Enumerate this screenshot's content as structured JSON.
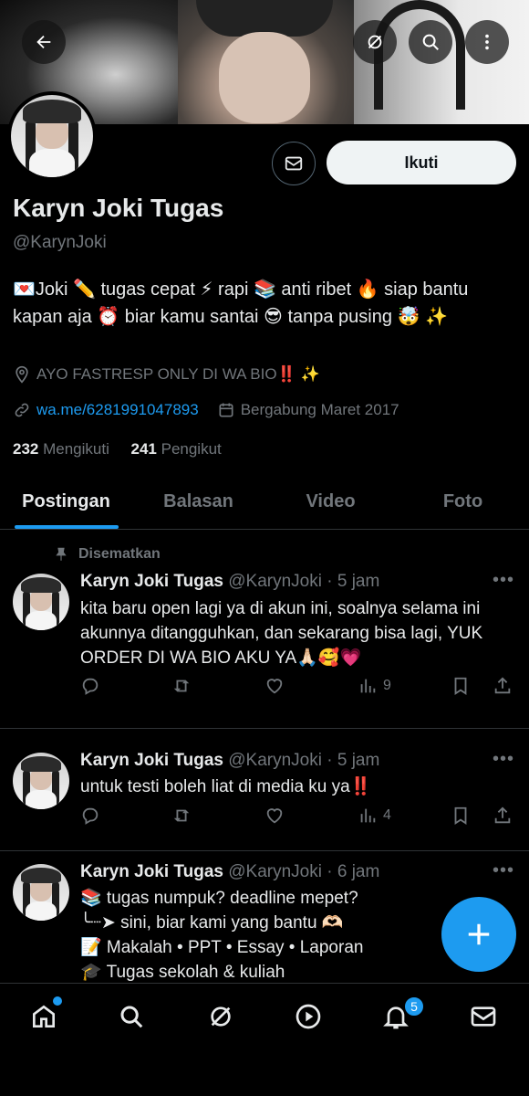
{
  "header": {
    "back_icon": "arrow-left-icon",
    "grok_icon": "grok-icon",
    "search_icon": "search-icon",
    "more_icon": "more-vertical-icon"
  },
  "profile": {
    "name": "Karyn Joki Tugas",
    "handle": "@KarynJoki",
    "bio": "💌Joki ✏️ tugas cepat ⚡ rapi 📚 anti ribet 🔥 siap bantu kapan aja ⏰ biar kamu santai 😎 tanpa pusing 🤯 ✨",
    "location": "AYO FASTRESP ONLY DI WA BIO‼️ ✨",
    "link": "wa.me/6281991047893",
    "joined": "Bergabung Maret 2017",
    "following_count": "232",
    "following_label": "Mengikuti",
    "followers_count": "241",
    "followers_label": "Pengikut",
    "follow_label": "Ikuti"
  },
  "tabs": [
    {
      "label": "Postingan",
      "active": true
    },
    {
      "label": "Balasan",
      "active": false
    },
    {
      "label": "Video",
      "active": false
    },
    {
      "label": "Foto",
      "active": false
    }
  ],
  "posts": [
    {
      "pinned_label": "Disematkan",
      "name": "Karyn Joki Tugas",
      "handle_time": "@KarynJoki · 5 jam",
      "text": "kita baru open lagi ya di akun ini, soalnya selama ini akunnya ditangguhkan, dan sekarang bisa lagi, YUK ORDER DI WA BIO AKU YA🙏🏻🥰💗",
      "views": "9"
    },
    {
      "name": "Karyn Joki Tugas",
      "handle_time": "@KarynJoki · 5 jam",
      "text": "untuk testi boleh liat di media ku ya‼️",
      "views": "4"
    },
    {
      "name": "Karyn Joki Tugas",
      "handle_time": "@KarynJoki · 6 jam",
      "lines": [
        "📚 tugas numpuk? deadline mepet?",
        "╰┈➤ sini, biar kami yang bantu 🫶🏻",
        "📝 Makalah • PPT • Essay • Laporan",
        "🎓 Tugas sekolah & kuliah"
      ]
    }
  ],
  "bottom_nav": {
    "notification_badge": "5",
    "items": [
      "home-icon",
      "search-icon",
      "grok-icon",
      "video-icon",
      "bell-icon",
      "mail-icon"
    ]
  },
  "colors": {
    "accent": "#1d9bf0",
    "background": "#000000",
    "text_primary": "#e7e9ea",
    "text_secondary": "#71767b",
    "border": "#2f3336"
  }
}
